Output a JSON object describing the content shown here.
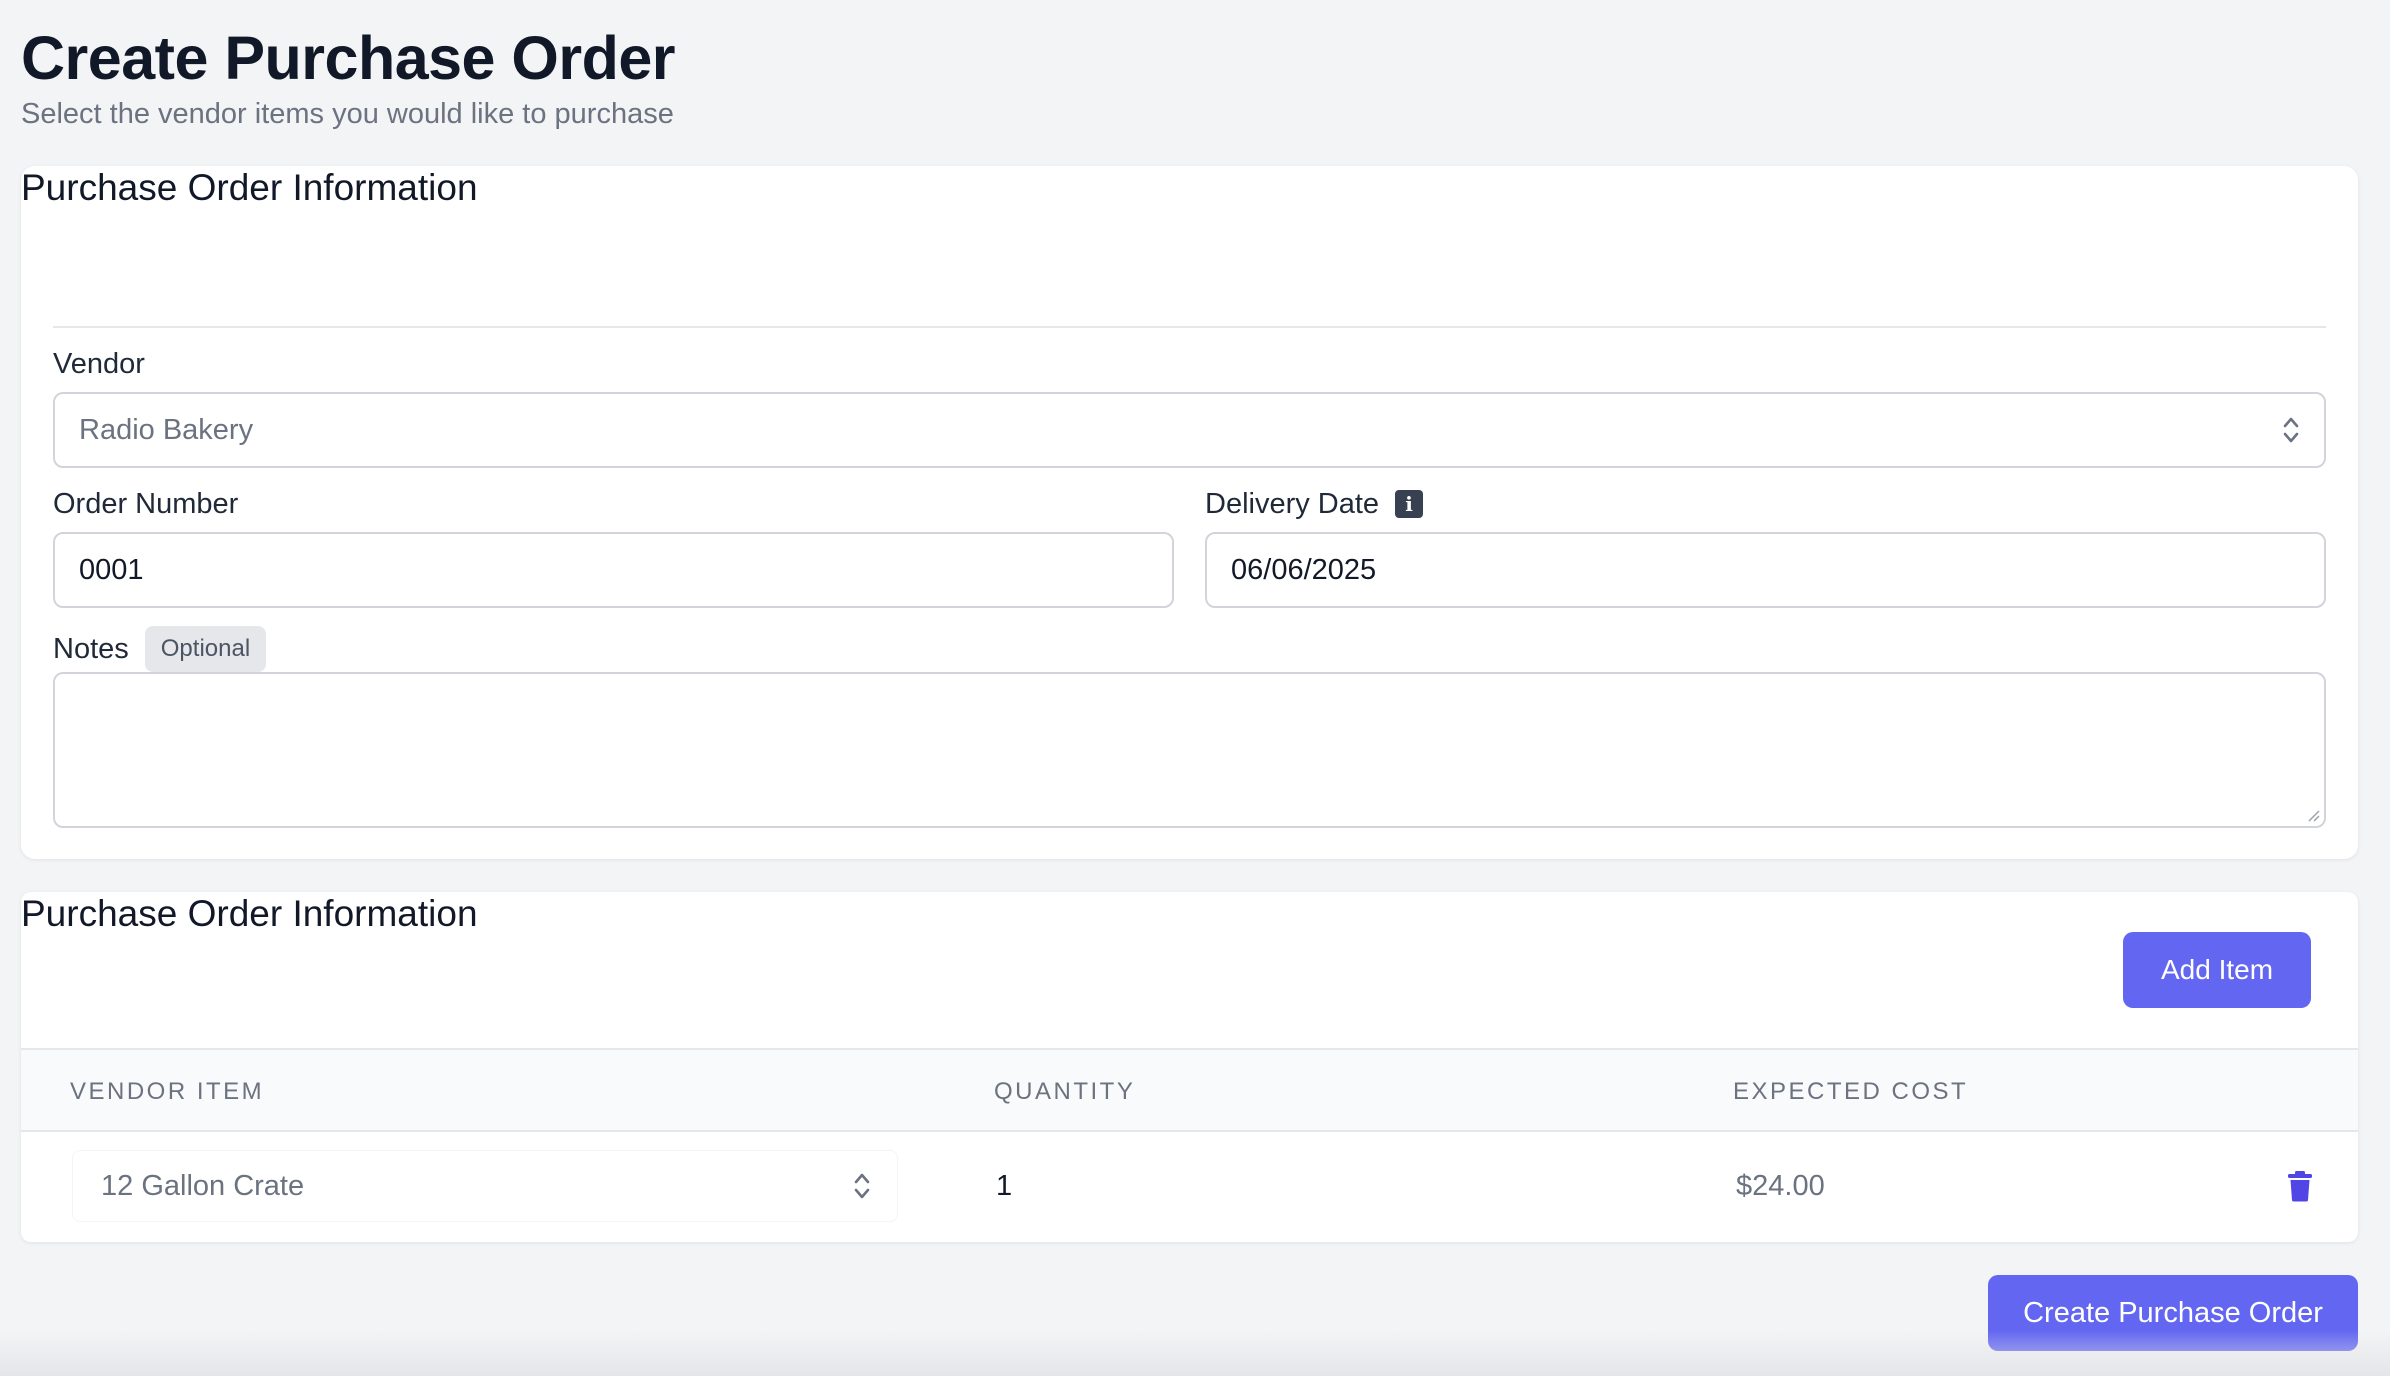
{
  "header": {
    "title": "Create Purchase Order",
    "subtitle": "Select the vendor items you would like to purchase"
  },
  "info_card": {
    "title": "Purchase Order Information",
    "vendor": {
      "label": "Vendor",
      "value": "Radio Bakery"
    },
    "order_number": {
      "label": "Order Number",
      "value": "0001"
    },
    "delivery_date": {
      "label": "Delivery Date",
      "value": "06/06/2025",
      "icon": "info-icon"
    },
    "notes": {
      "label": "Notes",
      "badge": "Optional",
      "value": ""
    }
  },
  "items_card": {
    "title": "Purchase Order Information",
    "add_button": "Add Item",
    "columns": [
      "VENDOR ITEM",
      "QUANTITY",
      "EXPECTED COST"
    ],
    "rows": [
      {
        "vendor_item": "12 Gallon Crate",
        "quantity": "1",
        "expected_cost": "$24.00",
        "action_icon": "trash-icon"
      }
    ]
  },
  "footer": {
    "create_button": "Create Purchase Order"
  },
  "colors": {
    "accent": "#6366f1",
    "background": "#f3f4f6",
    "muted_text": "#6b7280"
  }
}
